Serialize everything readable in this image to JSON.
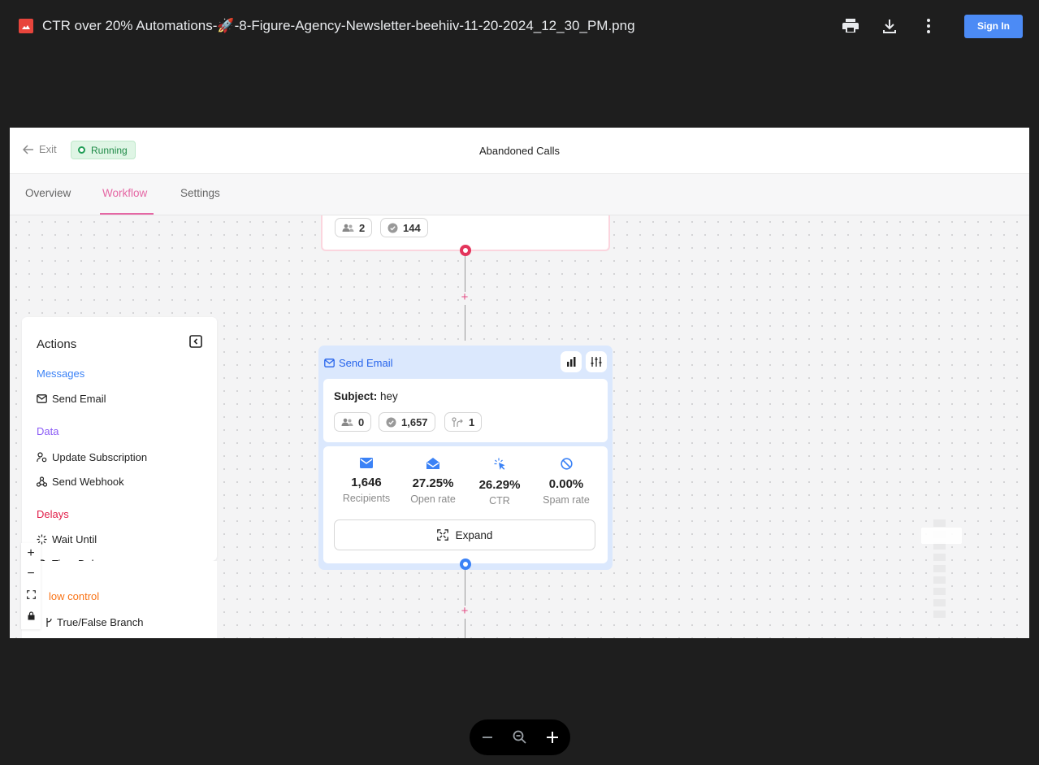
{
  "viewer": {
    "file_title": "CTR over 20% Automations-🚀-8-Figure-Agency-Newsletter-beehiiv-11-20-2024_12_30_PM.png",
    "sign_in_label": "Sign In",
    "icons": [
      "image-file-icon",
      "print-icon",
      "download-icon",
      "more-vert-icon",
      "zoom-out-icon",
      "magnifier-icon",
      "zoom-in-icon"
    ]
  },
  "workflow": {
    "exit_label": "Exit",
    "status_badge": "Running",
    "title": "Abandoned Calls",
    "tabs": [
      {
        "label": "Overview",
        "active": false
      },
      {
        "label": "Workflow",
        "active": true
      },
      {
        "label": "Settings",
        "active": false
      }
    ],
    "prev_step": {
      "subscribers": "2",
      "completed": "144"
    }
  },
  "actions_panel": {
    "title": "Actions",
    "sections": [
      {
        "label": "Messages",
        "color": "#3b82f6",
        "items": [
          "Send Email"
        ]
      },
      {
        "label": "Data",
        "color": "#8b5cf6",
        "items": [
          "Update Subscription",
          "Send Webhook"
        ]
      },
      {
        "label": "Delays",
        "color": "#e11d48",
        "items": [
          "Wait Until",
          "Time Delay"
        ]
      },
      {
        "label": "low control",
        "color": "#f97316",
        "items": [
          "True/False Branch"
        ]
      }
    ]
  },
  "canvas_controls": {
    "zoom_in": "+",
    "zoom_out": "−"
  },
  "send_email_step": {
    "header": "Send Email",
    "subject_label": "Subject:",
    "subject_value": "hey",
    "chips": {
      "subscribers": "0",
      "completed": "1,657",
      "branch": "1"
    },
    "stats": [
      {
        "value": "1,646",
        "label": "Recipients",
        "icon": "envelope-icon"
      },
      {
        "value": "27.25%",
        "label": "Open rate",
        "icon": "open-envelope-icon"
      },
      {
        "value": "26.29%",
        "label": "CTR",
        "icon": "cursor-click-icon"
      },
      {
        "value": "0.00%",
        "label": "Spam rate",
        "icon": "ban-icon"
      }
    ],
    "expand_label": "Expand"
  },
  "colors": {
    "accent_pink": "#e567a4",
    "accent_blue": "#3b82f6",
    "running_green": "#1f8a47",
    "viewer_bg": "#1e1e1e"
  }
}
